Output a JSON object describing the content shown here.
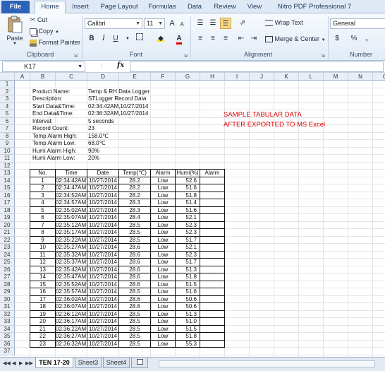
{
  "ribbon": {
    "tabs": [
      "File",
      "Home",
      "Insert",
      "Page Layout",
      "Formulas",
      "Data",
      "Review",
      "View",
      "Nitro PDF Professional 7"
    ],
    "clipboard": {
      "paste": "Paste",
      "cut": "Cut",
      "copy": "Copy",
      "format_painter": "Format Painter",
      "label": "Clipboard"
    },
    "font": {
      "name": "Calibri",
      "size": "11",
      "bold": "B",
      "italic": "I",
      "underline": "U",
      "grow": "A",
      "shrink": "A",
      "label": "Font"
    },
    "alignment": {
      "wrap_text": "Wrap Text",
      "merge_center": "Merge & Center",
      "label": "Alignment"
    },
    "number": {
      "format": "General",
      "currency": "$",
      "percent": "%",
      "comma": ",",
      "label": "Number"
    },
    "accent": "#2a63b8"
  },
  "formula_bar": {
    "name_box": "K17",
    "fx": "fx",
    "value": ""
  },
  "columns": [
    "A",
    "B",
    "C",
    "D",
    "E",
    "F",
    "G",
    "H",
    "I",
    "J",
    "K",
    "L",
    "M",
    "N",
    "O",
    "P"
  ],
  "rows": [
    "1",
    "2",
    "3",
    "4",
    "5",
    "6",
    "7",
    "8",
    "9",
    "10",
    "11",
    "12",
    "13",
    "14",
    "15",
    "16",
    "17",
    "18",
    "19",
    "20",
    "21",
    "22",
    "23",
    "24",
    "25",
    "26",
    "27",
    "28",
    "29",
    "30",
    "31",
    "32",
    "33",
    "34",
    "35",
    "36",
    "37"
  ],
  "info": [
    {
      "label": "Product Name:",
      "value": "Temp & RH Data Logger"
    },
    {
      "label": "Description:",
      "value": "STLogger Record Data"
    },
    {
      "label": "Start Data&Time:",
      "value": "02:34:42AM,10/27/2014"
    },
    {
      "label": "End Data&Time:",
      "value": "02:36:32AM,10/27/2014"
    },
    {
      "label": "Interval:",
      "value": "5 seconds"
    },
    {
      "label": "Record Count:",
      "value": "23"
    },
    {
      "label": "Temp Alarm High:",
      "value": "158.0℃"
    },
    {
      "label": "Temp Alarm Low:",
      "value": "68.0℃"
    },
    {
      "label": "Humi Alarm High:",
      "value": "90%"
    },
    {
      "label": "Humi Alarm Low:",
      "value": "20%"
    }
  ],
  "note": {
    "line1": "SAMPLE TABULAR DATA",
    "line2": "AFTER EXPORTED TO MS Excel",
    "color": "#e00000"
  },
  "table": {
    "headers": [
      "No.",
      "Time",
      "Date",
      "Temp(℃)",
      "Alarm",
      "Humi(%)",
      "Alarm"
    ],
    "rows": [
      [
        "1",
        "02:34:42AM",
        "10/27/2014",
        "28.2",
        "Low",
        "52.6",
        ""
      ],
      [
        "2",
        "02:34:47AM",
        "10/27/2014",
        "28.2",
        "Low",
        "51.6",
        ""
      ],
      [
        "3",
        "02:34:52AM",
        "10/27/2014",
        "28.2",
        "Low",
        "51.8",
        ""
      ],
      [
        "4",
        "02:34:57AM",
        "10/27/2014",
        "28.3",
        "Low",
        "51.4",
        ""
      ],
      [
        "5",
        "02:35:02AM",
        "10/27/2014",
        "28.3",
        "Low",
        "51.6",
        ""
      ],
      [
        "6",
        "02:35:07AM",
        "10/27/2014",
        "28.4",
        "Low",
        "52.1",
        ""
      ],
      [
        "7",
        "02:35:12AM",
        "10/27/2014",
        "28.5",
        "Low",
        "52.3",
        ""
      ],
      [
        "8",
        "02:35:17AM",
        "10/27/2014",
        "28.5",
        "Low",
        "52.3",
        ""
      ],
      [
        "9",
        "02:35:22AM",
        "10/27/2014",
        "28.5",
        "Low",
        "51.7",
        ""
      ],
      [
        "10",
        "02:35:27AM",
        "10/27/2014",
        "28.6",
        "Low",
        "52.1",
        ""
      ],
      [
        "11",
        "02:35:32AM",
        "10/27/2014",
        "28.6",
        "Low",
        "52.3",
        ""
      ],
      [
        "12",
        "02:35:37AM",
        "10/27/2014",
        "28.6",
        "Low",
        "51.7",
        ""
      ],
      [
        "13",
        "02:35:42AM",
        "10/27/2014",
        "28.6",
        "Low",
        "51.3",
        ""
      ],
      [
        "14",
        "02:35:47AM",
        "10/27/2014",
        "28.6",
        "Low",
        "51.8",
        ""
      ],
      [
        "15",
        "02:35:52AM",
        "10/27/2014",
        "28.6",
        "Low",
        "51.5",
        ""
      ],
      [
        "16",
        "02:35:57AM",
        "10/27/2014",
        "28.5",
        "Low",
        "51.6",
        ""
      ],
      [
        "17",
        "02:36:02AM",
        "10/27/2014",
        "28.6",
        "Low",
        "50.6",
        ""
      ],
      [
        "18",
        "02:36:07AM",
        "10/27/2014",
        "28.6",
        "Low",
        "50.6",
        ""
      ],
      [
        "19",
        "02:36:12AM",
        "10/27/2014",
        "28.5",
        "Low",
        "51.3",
        ""
      ],
      [
        "20",
        "02:36:17AM",
        "10/27/2014",
        "28.5",
        "Low",
        "51.0",
        ""
      ],
      [
        "21",
        "02:36:22AM",
        "10/27/2014",
        "28.5",
        "Low",
        "51.5",
        ""
      ],
      [
        "22",
        "02:36:27AM",
        "10/27/2014",
        "28.5",
        "Low",
        "51.8",
        ""
      ],
      [
        "23",
        "02:36:32AM",
        "10/27/2014",
        "28.5",
        "Low",
        "55.3",
        ""
      ]
    ]
  },
  "sheets": {
    "active": "TEN 17-20",
    "others": [
      "Sheet3",
      "Sheet4"
    ]
  }
}
